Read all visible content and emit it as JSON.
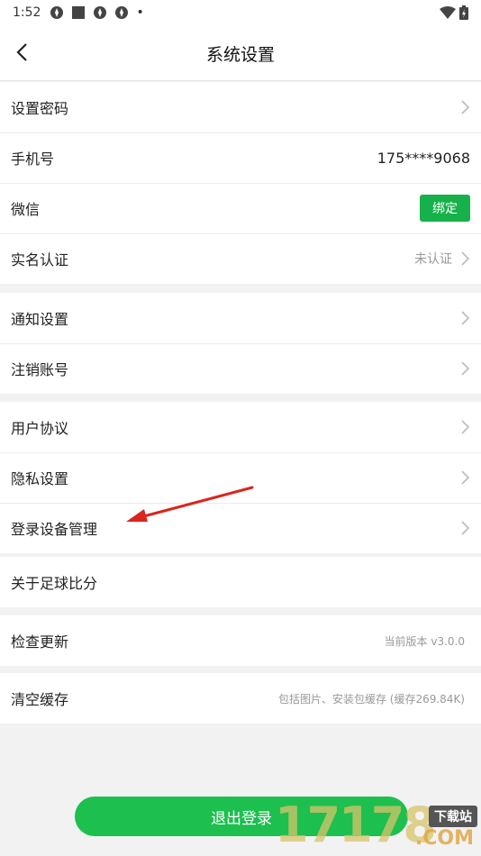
{
  "statusbar": {
    "time": "1:52",
    "dot": "•"
  },
  "header": {
    "title": "系统设置"
  },
  "groups": {
    "account": {
      "set_password": {
        "label": "设置密码"
      },
      "phone": {
        "label": "手机号",
        "value": "175****9068"
      },
      "wechat": {
        "label": "微信",
        "button": "绑定"
      },
      "realname": {
        "label": "实名认证",
        "hint": "未认证"
      }
    },
    "privacy": {
      "notification": {
        "label": "通知设置"
      },
      "cancel_account": {
        "label": "注销账号"
      }
    },
    "legal": {
      "user_agreement": {
        "label": "用户协议"
      },
      "privacy_settings": {
        "label": "隐私设置"
      },
      "device_mgmt": {
        "label": "登录设备管理"
      }
    },
    "about": {
      "label": "关于足球比分"
    },
    "update": {
      "label": "检查更新",
      "hint": "当前版本 v3.0.0"
    },
    "cache": {
      "label": "清空缓存",
      "hint": "包括图片、安装包缓存 (缓存269.84K)"
    }
  },
  "logout": {
    "label": "退出登录"
  },
  "watermark": {
    "number": "17178",
    "tag": "下载站",
    "suffix": ".COM"
  },
  "colors": {
    "accent_green": "#1dbf4f",
    "bind_green": "#16b14a",
    "annotation_red": "#d9251d"
  }
}
